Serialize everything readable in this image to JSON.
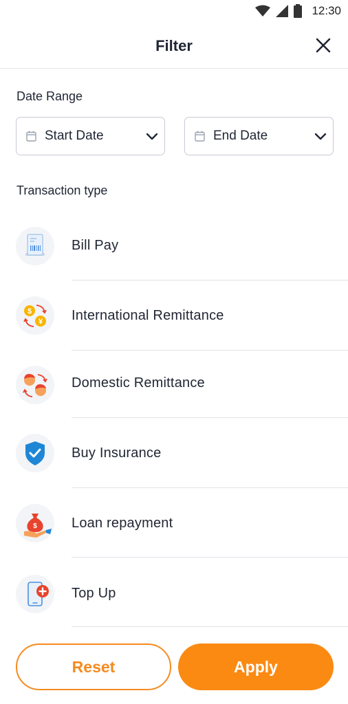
{
  "status_bar": {
    "time": "12:30"
  },
  "header": {
    "title": "Filter"
  },
  "date_range": {
    "label": "Date Range",
    "start_placeholder": "Start Date",
    "end_placeholder": "End Date"
  },
  "transaction_type": {
    "label": "Transaction type",
    "items": [
      {
        "label": "Bill Pay",
        "icon": "bill-icon"
      },
      {
        "label": "International Remittance",
        "icon": "currency-exchange-icon"
      },
      {
        "label": "Domestic Remittance",
        "icon": "people-exchange-icon"
      },
      {
        "label": "Buy Insurance",
        "icon": "shield-check-icon"
      },
      {
        "label": "Loan repayment",
        "icon": "money-bag-hand-icon"
      },
      {
        "label": "Top Up",
        "icon": "phone-plus-icon"
      }
    ]
  },
  "actions": {
    "reset_label": "Reset",
    "apply_label": "Apply"
  },
  "colors": {
    "accent": "#fb8a12",
    "text": "#1f2533",
    "border": "#c7cbd6",
    "icon_bg": "#f2f4f7"
  }
}
